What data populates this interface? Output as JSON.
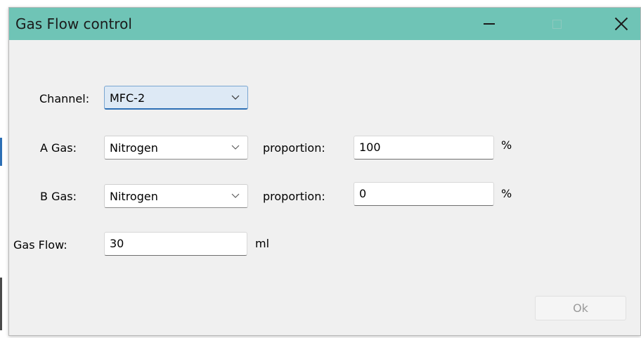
{
  "window": {
    "title": "Gas Flow control",
    "controls": {
      "minimize_icon": "minimize-icon",
      "maximize_icon": "maximize-icon",
      "close_icon": "close-icon"
    },
    "titlebar_color": "#6fc4b6"
  },
  "form": {
    "channel": {
      "label": "Channel:",
      "value": "MFC-2"
    },
    "a_gas": {
      "label": "A Gas:",
      "value": "Nitrogen",
      "proportion_label": "proportion:",
      "proportion_value": "100",
      "unit": "%"
    },
    "b_gas": {
      "label": "B Gas:",
      "value": "Nitrogen",
      "proportion_label": "proportion:",
      "proportion_value": "0",
      "unit": "%"
    },
    "gas_flow": {
      "label": "Gas Flow:",
      "value": "30",
      "unit": "ml"
    }
  },
  "buttons": {
    "ok_label": "Ok"
  }
}
